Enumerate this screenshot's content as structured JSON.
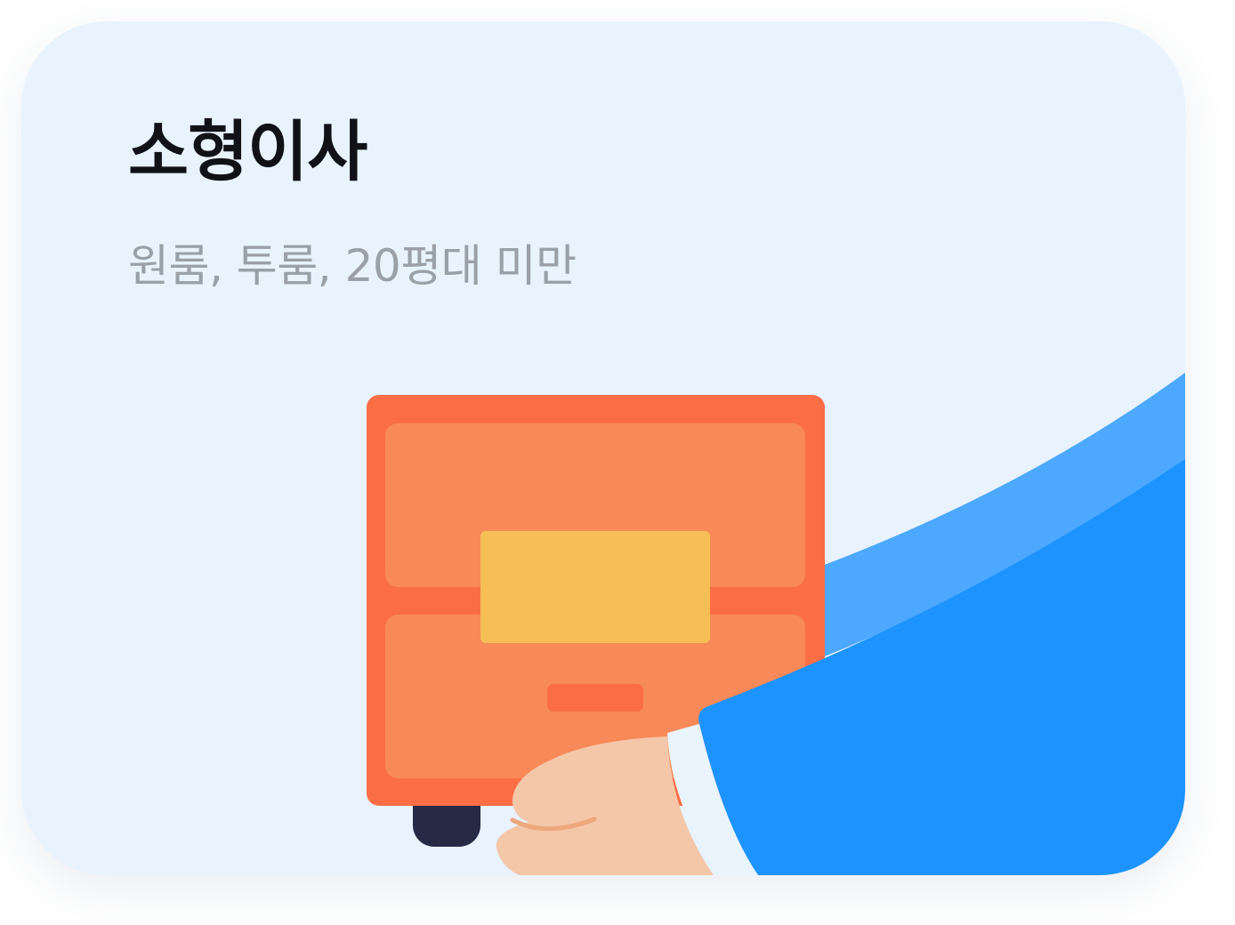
{
  "card": {
    "title": "소형이사",
    "subtitle": "원룸, 투룸, 20평대 미만"
  },
  "illustration": {
    "icon": "moving-drawer-illustration",
    "colors": {
      "background": "#e8f3fe",
      "drawer_frame": "#fb6e45",
      "drawer_face": "#f78a58",
      "label": "#f6bf56",
      "wheel": "#262a45",
      "sleeve_light": "#4da8ff",
      "sleeve_dark": "#1c93ff",
      "cuff": "#eaf4fc",
      "hand": "#f4c7a9"
    }
  }
}
